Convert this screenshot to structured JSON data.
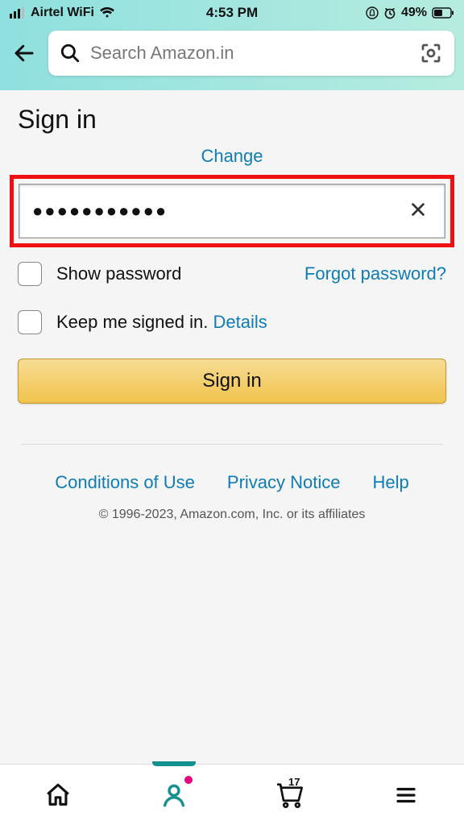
{
  "status": {
    "carrier": "Airtel WiFi",
    "time": "4:53 PM",
    "battery_pct": "49%"
  },
  "header": {
    "search_placeholder": "Search Amazon.in"
  },
  "page": {
    "title": "Sign in",
    "change": "Change",
    "password_masked": "●●●●●●●●●●●",
    "show_password": "Show password",
    "forgot": "Forgot password?",
    "keep_signed": "Keep me signed in. ",
    "details": "Details",
    "signin_button": "Sign in"
  },
  "footer": {
    "conditions": "Conditions of Use",
    "privacy": "Privacy Notice",
    "help": "Help",
    "copyright": "© 1996-2023, Amazon.com, Inc. or its affiliates"
  },
  "nav": {
    "cart_count": "17"
  }
}
